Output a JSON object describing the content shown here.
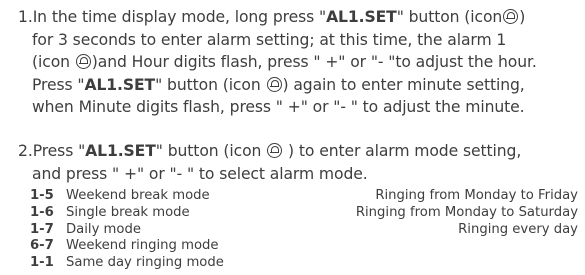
{
  "step1": {
    "number": "1.",
    "l1_a": "In the time display mode, long press \"",
    "l1_btn": "AL1.SET",
    "l1_b": "\" button (icon",
    "l1_c": ")",
    "l2_a": "for 3 seconds to enter alarm setting; at this time, the  alarm 1",
    "l3_a": "(icon",
    "l3_b": ")and Hour digits flash, press \" +\" or \"- \"to adjust the hour.",
    "l4_a": "Press \"",
    "l4_btn": "AL1.SET",
    "l4_b": "\" button (icon",
    "l4_c": ") again to enter minute setting,",
    "l5_a": "when Minute digits flash, press \" +\" or \"- \" to adjust  the minute."
  },
  "step2": {
    "number": "2.",
    "l1_a": "Press \"",
    "l1_btn": "AL1.SET",
    "l1_b": "\" button (icon",
    "l1_c": ") to enter alarm mode setting,",
    "l2_a": "and press \" +\" or \"- \" to select alarm mode."
  },
  "modes": [
    {
      "code": "1-5",
      "name": "Weekend break mode",
      "ring": "Ringing from Monday to Friday"
    },
    {
      "code": "1-6",
      "name": "Single break mode",
      "ring": "Ringing from Monday to Saturday"
    },
    {
      "code": "1-7",
      "name": "Daily mode",
      "ring": "Ringing every day"
    },
    {
      "code": "6-7",
      "name": "Weekend ringing mode",
      "ring": ""
    },
    {
      "code": "1-1",
      "name": "Same day ringing mode",
      "ring": ""
    }
  ],
  "icons": {
    "alarm": "alarm-bell-icon"
  }
}
